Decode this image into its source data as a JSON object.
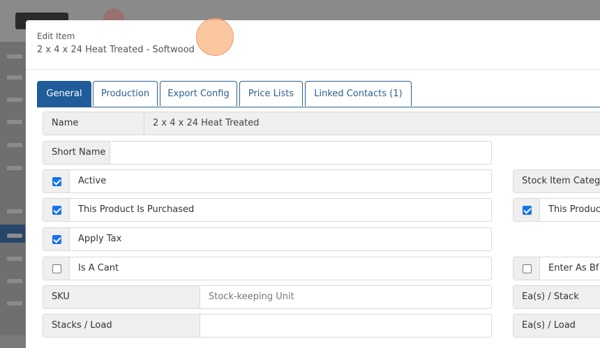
{
  "modal": {
    "eyebrow": "Edit Item",
    "subtitle": "2 x 4 x 24 Heat Treated - Softwood"
  },
  "tabs": [
    {
      "label": "General",
      "active": true
    },
    {
      "label": "Production",
      "active": false
    },
    {
      "label": "Export Config",
      "active": false
    },
    {
      "label": "Price Lists",
      "active": false
    },
    {
      "label": "Linked Contacts (1)",
      "active": false
    }
  ],
  "form": {
    "name": {
      "label": "Name",
      "value": "2 x 4 x 24 Heat Treated"
    },
    "short_name": {
      "label": "Short Name",
      "value": ""
    },
    "active": {
      "label": "Active",
      "checked": true
    },
    "purchased": {
      "label": "This Product Is Purchased",
      "checked": true
    },
    "apply_tax": {
      "label": "Apply Tax",
      "checked": true
    },
    "is_a_cant": {
      "label": "Is A Cant",
      "checked": false
    },
    "sku": {
      "label": "SKU",
      "placeholder": "Stock-keeping Unit",
      "value": ""
    },
    "stacks_load": {
      "label": "Stacks / Load",
      "value": ""
    }
  },
  "right_column": {
    "stock_item_category": {
      "label": "Stock Item Categor"
    },
    "this_product": {
      "label": "This Product",
      "checked": true
    },
    "enter_as_bf": {
      "label": "Enter As Bf",
      "checked": false
    },
    "ea_stack": {
      "label": "Ea(s) / Stack"
    },
    "ea_load": {
      "label": "Ea(s) / Load"
    }
  },
  "colors": {
    "accent": "#1f5c99",
    "checkbox": "#1a73e8"
  }
}
